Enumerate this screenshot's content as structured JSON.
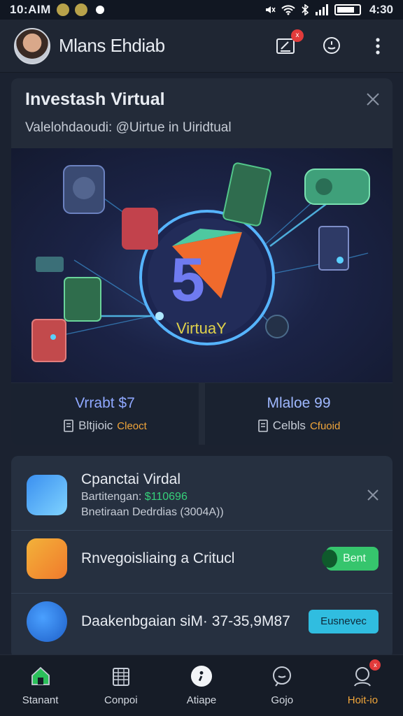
{
  "status_bar": {
    "time": "10:AIM",
    "clock": "4:30"
  },
  "header": {
    "username": "Mlans Ehdiab",
    "notification_count": "x"
  },
  "hero": {
    "title": "Investash Virtual",
    "subtitle": "Valelohdaoudi: @Uirtue in Uiridtual",
    "logo_text": "VirtuaY",
    "stats": [
      {
        "value": "Vrrabt $7",
        "meta_prefix": "Bltjioic",
        "meta_highlight": "Cleoct"
      },
      {
        "value": "Mlaloe 99",
        "meta_prefix": "Celbls",
        "meta_highlight": "Cfuoid"
      }
    ]
  },
  "list": {
    "items": [
      {
        "title": "Cpanctai Virdal",
        "line1_prefix": "Bartitengan:",
        "line1_value": "$110696",
        "line2": "Bnetiraan Dedrdias (3004A))"
      },
      {
        "title": "Rnvegoisliaing a Critucl",
        "button": "Bent"
      },
      {
        "title": "Daakenbgaian siM· 37-35,9M87",
        "button": "Eusnevec"
      }
    ]
  },
  "bottom_nav": [
    {
      "label": "Stanant",
      "icon": "home-icon"
    },
    {
      "label": "Conpoi",
      "icon": "calendar-icon"
    },
    {
      "label": "Atiape",
      "icon": "compass-icon"
    },
    {
      "label": "Gojo",
      "icon": "chat-icon"
    },
    {
      "label": "Hoit-io",
      "icon": "profile-icon",
      "active": true,
      "badge": "x"
    }
  ],
  "colors": {
    "accent": "#f0a53a",
    "green": "#36c56d",
    "cyan": "#30bde0",
    "background": "#1b2230"
  }
}
